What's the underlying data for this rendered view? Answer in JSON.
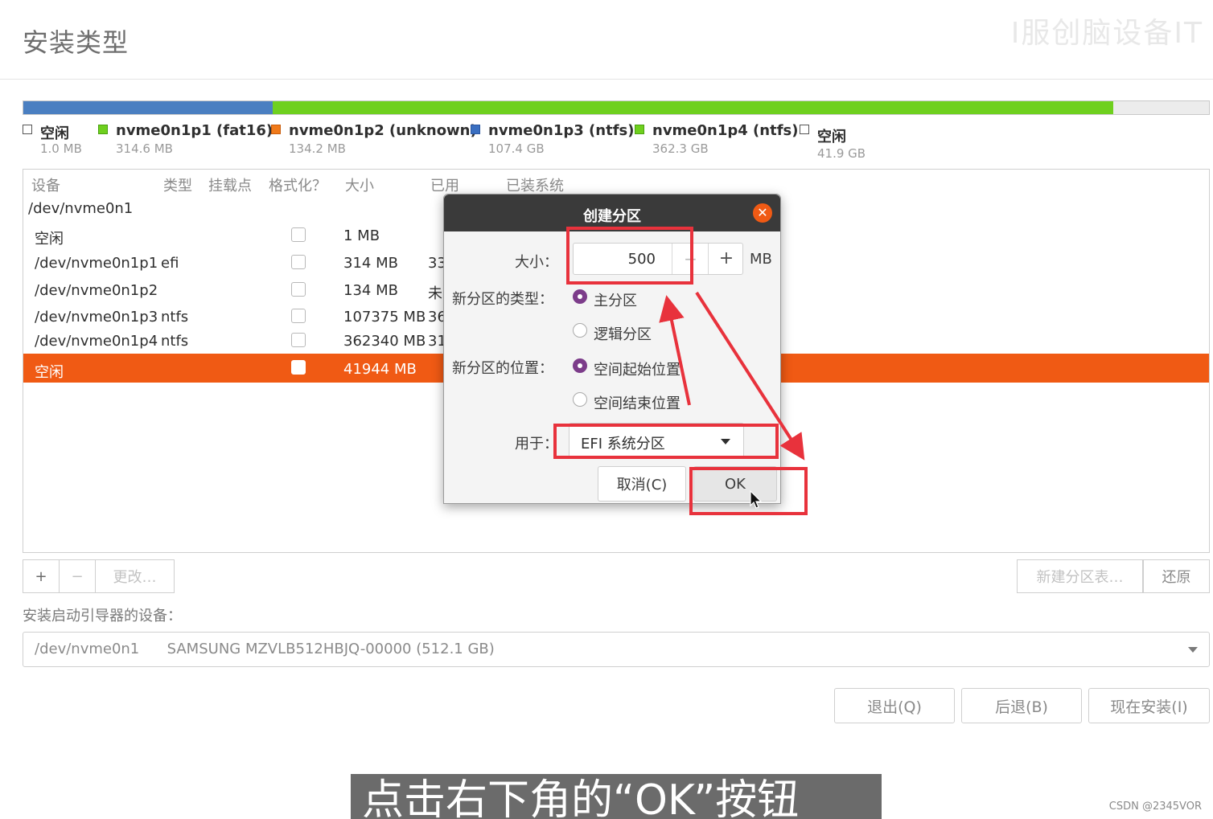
{
  "page": {
    "title": "安装类型",
    "watermark_top": "I服创脑设备IT"
  },
  "partition_bar": {
    "segments": [
      {
        "name": "nvme0n1p3 (ntfs)",
        "color": "#4a7fc1",
        "fraction": 0.213
      },
      {
        "name": "nvme0n1p4 (ntfs)",
        "color": "#6fd01e",
        "fraction": 0.707
      },
      {
        "name": "空闲",
        "color": "#ececec",
        "fraction": 0.08
      }
    ]
  },
  "legend": [
    {
      "label": "空闲",
      "size": "1.0 MB",
      "color": "#ffffff",
      "outline": true
    },
    {
      "label": "nvme0n1p1 (fat16)",
      "size": "314.6 MB",
      "color": "#6fd01e"
    },
    {
      "label": "nvme0n1p2 (unknown)",
      "size": "134.2 MB",
      "color": "#f07a1a"
    },
    {
      "label": "nvme0n1p3 (ntfs)",
      "size": "107.4 GB",
      "color": "#3a6fc1"
    },
    {
      "label": "nvme0n1p4 (ntfs)",
      "size": "362.3 GB",
      "color": "#6fd01e"
    },
    {
      "label": "空闲",
      "size": "41.9 GB",
      "color": "#ffffff",
      "outline": true
    }
  ],
  "table": {
    "headers": {
      "device": "设备",
      "type": "类型",
      "mount": "挂载点",
      "format": "格式化？",
      "size": "大小",
      "used": "已用",
      "system": "已装系统"
    },
    "group": "/dev/nvme0n1",
    "rows": [
      {
        "device": "空闲",
        "type": "",
        "size": "1 MB",
        "used": ""
      },
      {
        "device": "/dev/nvme0n1p1",
        "type": "efi",
        "size": "314 MB",
        "used": "33"
      },
      {
        "device": "/dev/nvme0n1p2",
        "type": "",
        "size": "134 MB",
        "used": "未"
      },
      {
        "device": "/dev/nvme0n1p3",
        "type": "ntfs",
        "size": "107375 MB",
        "used": "36"
      },
      {
        "device": "/dev/nvme0n1p4",
        "type": "ntfs",
        "size": "362340 MB",
        "used": "31"
      },
      {
        "device": "空闲",
        "type": "",
        "size": "41944 MB",
        "used": "",
        "selected": true
      }
    ]
  },
  "toolbar": {
    "add": "+",
    "remove": "−",
    "change": "更改…",
    "new_table": "新建分区表…",
    "revert": "还原"
  },
  "bootloader": {
    "label": "安装启动引导器的设备：",
    "device": "/dev/nvme0n1",
    "model": "SAMSUNG MZVLB512HBJQ-00000 (512.1 GB)"
  },
  "nav": {
    "quit": "退出(Q)",
    "back": "后退(B)",
    "install": "现在安装(I)"
  },
  "dialog": {
    "title": "创建分区",
    "size_label": "大小：",
    "size_value": "500",
    "size_minus": "−",
    "size_plus": "+",
    "size_unit": "MB",
    "type_label": "新分区的类型：",
    "type_primary": "主分区",
    "type_logical": "逻辑分区",
    "location_label": "新分区的位置：",
    "location_begin": "空间起始位置",
    "location_end": "空间结束位置",
    "use_label": "用于：",
    "use_value": "EFI 系统分区",
    "cancel": "取消(C)",
    "ok": "OK"
  },
  "annotation_color": "#e8323c",
  "subtitle": "点击右下角的“OK”按钮",
  "credit": "CSDN @2345VOR"
}
